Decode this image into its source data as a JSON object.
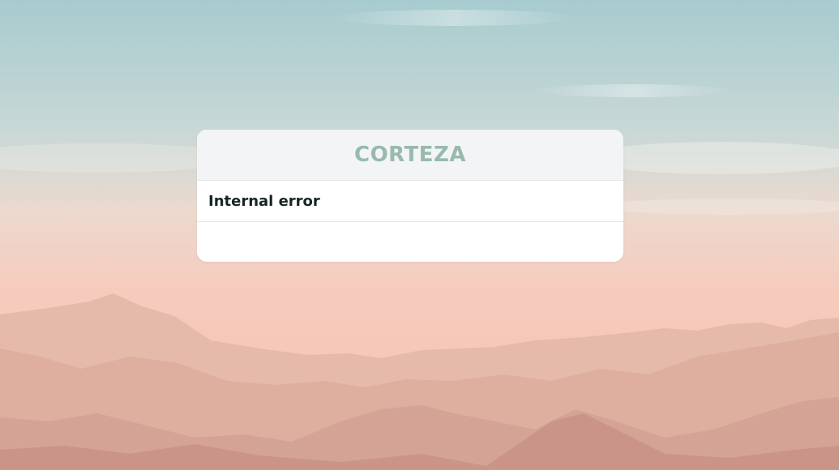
{
  "brand": {
    "logo_text": "CORTEZA"
  },
  "error": {
    "title": "Internal error"
  },
  "colors": {
    "logo": "#98b9ae",
    "title_text": "#162425",
    "header_bg": "#f3f4f6",
    "card_bg": "#ffffff",
    "sky_top": "#a9cdd0",
    "sky_bottom": "#f6c9bd",
    "mountains": "#d7a99a"
  },
  "icons": {
    "background": "mountain-landscape-image"
  }
}
